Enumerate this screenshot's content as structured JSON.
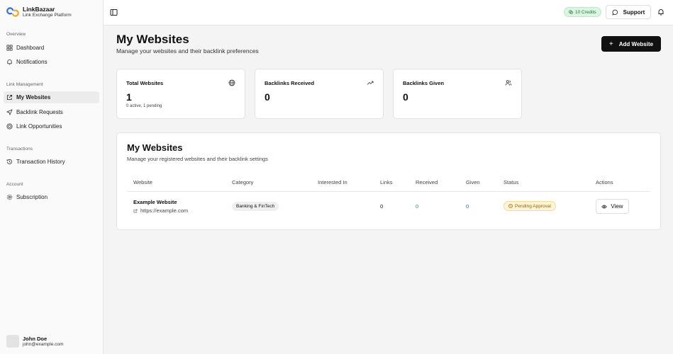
{
  "brand": {
    "name": "LinkBazaar",
    "subtitle": "Link Exchange Platform"
  },
  "sidebar": {
    "sections": [
      {
        "label": "Overview",
        "items": [
          {
            "label": "Dashboard",
            "icon": "grid-icon"
          },
          {
            "label": "Notifications",
            "icon": "bell-icon"
          }
        ]
      },
      {
        "label": "Link Management",
        "items": [
          {
            "label": "My Websites",
            "icon": "external-link-icon",
            "active": true
          },
          {
            "label": "Backlink Requests",
            "icon": "send-icon"
          },
          {
            "label": "Link Opportunities",
            "icon": "target-icon"
          }
        ]
      },
      {
        "label": "Transactions",
        "items": [
          {
            "label": "Transaction History",
            "icon": "history-icon"
          }
        ]
      },
      {
        "label": "Account",
        "items": [
          {
            "label": "Subscription",
            "icon": "gear-icon"
          }
        ]
      }
    ]
  },
  "user": {
    "name": "John Doe",
    "email": "john@example.com"
  },
  "topbar": {
    "credits": "10 Credits",
    "support_label": "Support"
  },
  "page": {
    "title": "My Websites",
    "subtitle": "Manage your websites and their backlink preferences",
    "add_button": "Add Website"
  },
  "stats": [
    {
      "label": "Total Websites",
      "value": "1",
      "note": "0 active, 1 pending",
      "icon": "globe-icon"
    },
    {
      "label": "Backlinks Received",
      "value": "0",
      "icon": "trending-up-icon"
    },
    {
      "label": "Backlinks Given",
      "value": "0",
      "icon": "users-icon"
    }
  ],
  "table": {
    "title": "My Websites",
    "subtitle": "Manage your registered websites and their backlink settings",
    "columns": [
      "Website",
      "Category",
      "Interested In",
      "Links",
      "Received",
      "Given",
      "Status",
      "Actions"
    ],
    "rows": [
      {
        "name": "Example Website",
        "url": "https://example.com",
        "category": "Banking & FinTech",
        "links": "0",
        "received": "0",
        "given": "0",
        "status": "Pending Approval",
        "action": "View"
      }
    ]
  },
  "colors": {
    "received": "#16a34a",
    "given": "#2563eb",
    "pending_bg": "#fff4d6",
    "credits_bg": "#dcf5e3"
  }
}
